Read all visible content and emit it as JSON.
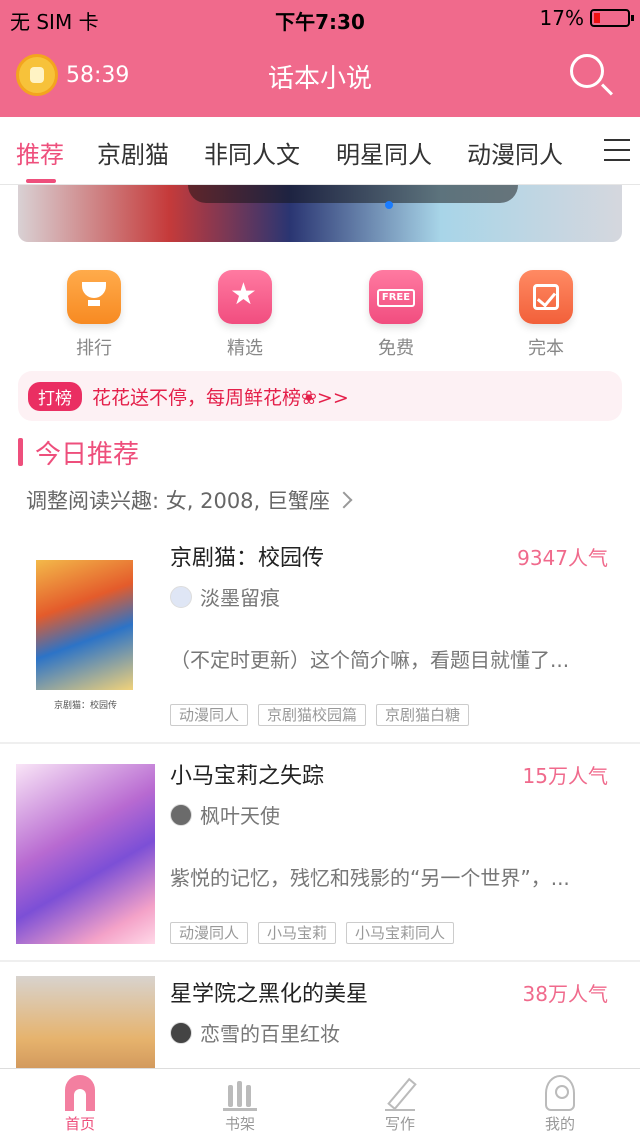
{
  "status_bar": {
    "carrier": "无 SIM 卡",
    "time": "下午7:30",
    "battery": "17%"
  },
  "header": {
    "timer": "58:39",
    "title": "话本小说"
  },
  "tabs": [
    "推荐",
    "京剧猫",
    "非同人文",
    "明星同人",
    "动漫同人"
  ],
  "categories": [
    {
      "label": "排行",
      "icon": "trophy-icon"
    },
    {
      "label": "精选",
      "icon": "star-icon"
    },
    {
      "label": "免费",
      "icon": "free-icon",
      "icon_text": "FREE"
    },
    {
      "label": "完本",
      "icon": "check-icon"
    }
  ],
  "promo": {
    "badge": "打榜",
    "text": "花花送不停，每周鲜花榜❀>>"
  },
  "section": {
    "title": "今日推荐",
    "preference": "调整阅读兴趣: 女, 2008, 巨蟹座"
  },
  "books": [
    {
      "title": "京剧猫：校园传",
      "popularity": "9347人气",
      "author": "淡墨留痕",
      "description": "（不定时更新）这个简介嘛，看题目就懂了...",
      "tags": [
        "动漫同人",
        "京剧猫校园篇",
        "京剧猫白糖"
      ],
      "cover_caption": "京剧猫：校园传"
    },
    {
      "title": "小马宝莉之失踪",
      "popularity": "15万人气",
      "author": "枫叶天使",
      "description": "紫悦的记忆，残忆和残影的“另一个世界”，...",
      "tags": [
        "动漫同人",
        "小马宝莉",
        "小马宝莉同人"
      ]
    },
    {
      "title": "星学院之黑化的美星",
      "popularity": "38万人气",
      "author": "恋雪的百里红妆"
    }
  ],
  "tabbar": [
    {
      "label": "首页",
      "icon": "home-icon"
    },
    {
      "label": "书架",
      "icon": "bookshelf-icon"
    },
    {
      "label": "写作",
      "icon": "pen-icon"
    },
    {
      "label": "我的",
      "icon": "profile-icon"
    }
  ],
  "colors": {
    "brand_pink": "#f06a8c",
    "accent": "#ee4f7c",
    "promo_red": "#e4204a"
  }
}
